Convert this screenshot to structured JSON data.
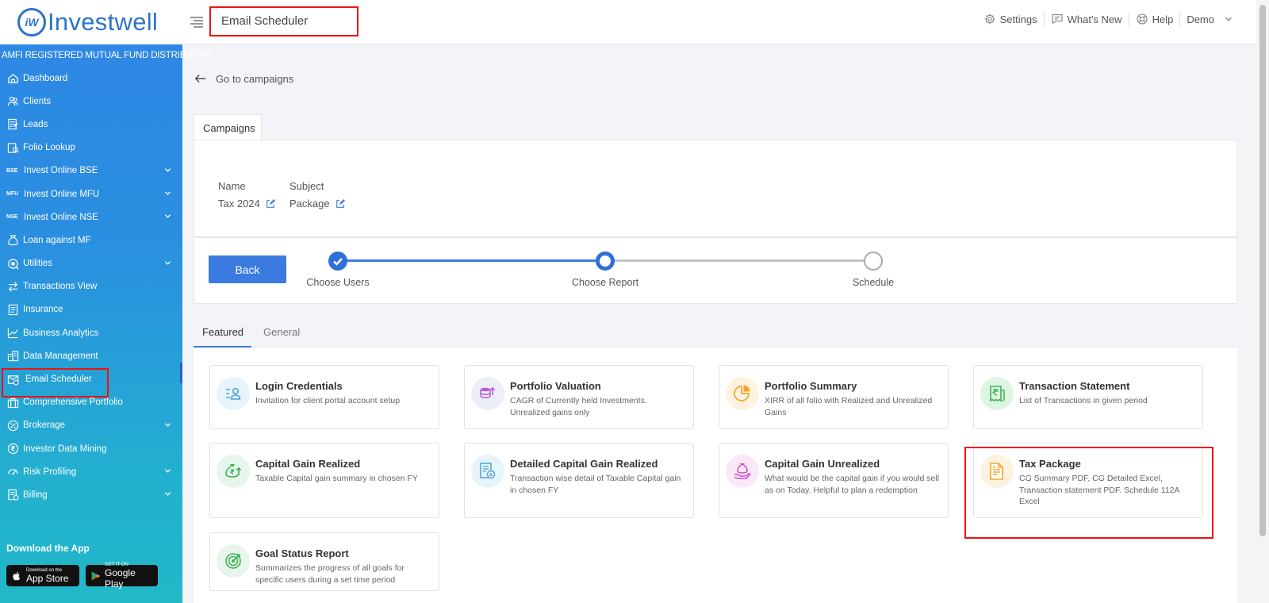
{
  "brand": {
    "logo_text": "iW",
    "name": "Investwell",
    "tagline": "AMFI REGISTERED MUTUAL FUND DISTRIBUTOR"
  },
  "sidebar": {
    "items": [
      {
        "label": "Dashboard",
        "icon": "home-icon",
        "chevron": false
      },
      {
        "label": "Clients",
        "icon": "users-icon",
        "chevron": false
      },
      {
        "label": "Leads",
        "icon": "leads-icon",
        "chevron": false
      },
      {
        "label": "Folio Lookup",
        "icon": "folio-icon",
        "chevron": false
      },
      {
        "label": "Invest Online BSE",
        "icon_text": "BSE",
        "chevron": true
      },
      {
        "label": "Invest Online MFU",
        "icon_text": "MFU",
        "chevron": true
      },
      {
        "label": "Invest Online NSE",
        "icon_text": "NSE",
        "chevron": true
      },
      {
        "label": "Loan against MF",
        "icon": "loan-icon",
        "chevron": false
      },
      {
        "label": "Utilities",
        "icon": "utilities-icon",
        "chevron": true
      },
      {
        "label": "Transactions View",
        "icon": "transfer-icon",
        "chevron": false
      },
      {
        "label": "Insurance",
        "icon": "insurance-icon",
        "chevron": false
      },
      {
        "label": "Business Analytics",
        "icon": "analytics-icon",
        "chevron": false
      },
      {
        "label": "Data Management",
        "icon": "data-icon",
        "chevron": false
      },
      {
        "label": "Email Scheduler",
        "icon": "email-icon",
        "chevron": false,
        "active": true
      },
      {
        "label": "Comprehensive Portfolio",
        "icon": "briefcase-icon",
        "chevron": false
      },
      {
        "label": "Brokerage",
        "icon": "percent-icon",
        "chevron": true
      },
      {
        "label": "Investor Data Mining",
        "icon": "rupee-icon",
        "chevron": false
      },
      {
        "label": "Risk Profiling",
        "icon": "gauge-icon",
        "chevron": true
      },
      {
        "label": "Billing",
        "icon": "billing-icon",
        "chevron": true
      }
    ],
    "download_label": "Download the App",
    "app_store": {
      "small": "Download on the",
      "big": "App Store"
    },
    "google_play": {
      "small": "GET IT ON",
      "big": "Google Play"
    }
  },
  "topbar": {
    "title": "Email Scheduler",
    "links": [
      {
        "label": "Settings",
        "icon": "gear-icon"
      },
      {
        "label": "What's New",
        "icon": "chat-icon"
      },
      {
        "label": "Help",
        "icon": "help-icon"
      }
    ],
    "user": "Demo"
  },
  "main": {
    "back_link": "Go to campaigns",
    "campaigns_tab": "Campaigns",
    "name_label": "Name",
    "name_value": "Tax 2024",
    "subject_label": "Subject",
    "subject_value": "Package",
    "back_button": "Back",
    "steps": [
      "Choose Users",
      "Choose Report",
      "Schedule"
    ],
    "report_tabs": [
      "Featured",
      "General"
    ],
    "reports": [
      {
        "title": "Login Credentials",
        "desc": "Invitation for client portal account setup",
        "icon": "login-icon",
        "color": "#e8f4fb"
      },
      {
        "title": "Portfolio Valuation",
        "desc": "CAGR of Currently held Investments. Unrealized gains only",
        "icon": "coins-icon",
        "color": "#eceff7"
      },
      {
        "title": "Portfolio Summary",
        "desc": "XIRR of all folio with Realized and Unrealized Gains",
        "icon": "pie-icon",
        "color": "#fdf3df"
      },
      {
        "title": "Transaction Statement",
        "desc": "List of Transactions in given period",
        "icon": "receipt-icon",
        "color": "#dff5e4"
      },
      {
        "title": "Capital Gain Realized",
        "desc": "Taxable Capital gain summary in chosen FY",
        "icon": "moneybag-icon",
        "color": "#e6f6ea"
      },
      {
        "title": "Detailed Capital Gain Realized",
        "desc": "Transaction wise detail of Taxable Capital gain in chosen FY",
        "icon": "report-icon",
        "color": "#e6f4fb"
      },
      {
        "title": "Capital Gain Unrealized",
        "desc": "What would be the capital gain if you would sell as on Today. Helpful to plan a redemption",
        "icon": "hand-money-icon",
        "color": "#fbe8f7"
      },
      {
        "title": "Tax Package",
        "desc": "CG Summary PDF, CG Detailed Excel, Transaction statement PDF. Schedule 112A Excel",
        "icon": "document-icon",
        "color": "#fdf2df"
      },
      {
        "title": "Goal Status Report",
        "desc": "Summarizes the progress of all goals for specific users during a set time period",
        "icon": "target-icon",
        "color": "#e8f5ea"
      }
    ]
  }
}
